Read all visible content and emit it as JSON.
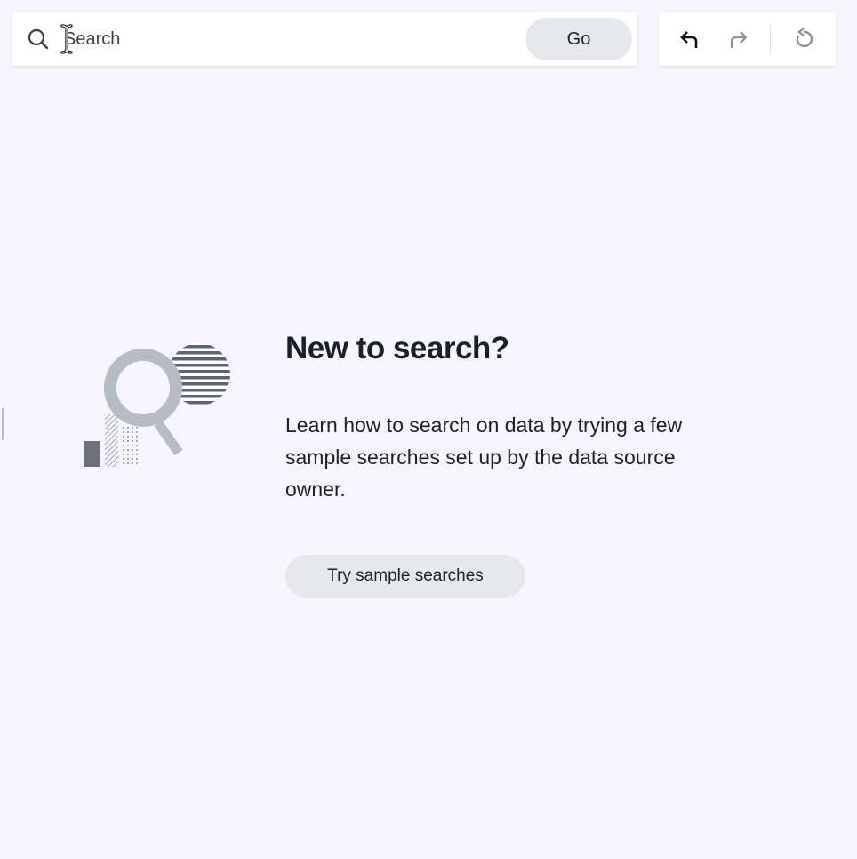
{
  "search": {
    "placeholder": "Search",
    "value": "",
    "go_label": "Go",
    "icon": "search-icon"
  },
  "history": {
    "undo_icon": "undo-icon",
    "redo_icon": "redo-icon",
    "reset_icon": "reset-icon"
  },
  "empty_state": {
    "illustration": "magnifier-chart-illustration",
    "heading": "New to search?",
    "description": "Learn how to search on data by trying a few sample searches set up by the data source owner.",
    "button_label": "Try sample searches"
  },
  "colors": {
    "background": "#f5f5fb",
    "panel": "#ffffff",
    "button_bg": "#e7e8ec",
    "text": "#1d2127",
    "muted_icon": "#8c9199",
    "illustration_gray": "#b6bcc4",
    "illustration_dark": "#5d6370"
  }
}
